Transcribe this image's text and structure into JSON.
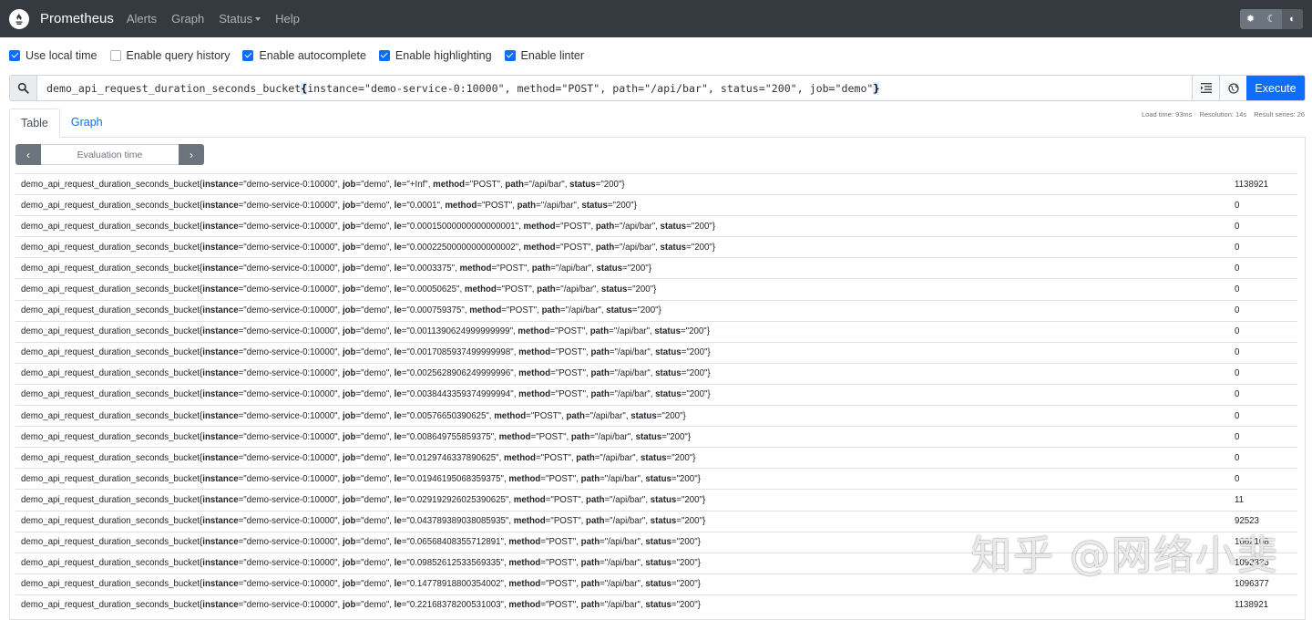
{
  "nav": {
    "brand": "Prometheus",
    "links": [
      "Alerts",
      "Graph",
      "Status",
      "Help"
    ]
  },
  "options": [
    {
      "label": "Use local time",
      "checked": true
    },
    {
      "label": "Enable query history",
      "checked": false
    },
    {
      "label": "Enable autocomplete",
      "checked": true
    },
    {
      "label": "Enable highlighting",
      "checked": true
    },
    {
      "label": "Enable linter",
      "checked": true
    }
  ],
  "query": {
    "metric": "demo_api_request_duration_seconds_bucket",
    "open_brace": "{",
    "labels": "instance=\"demo-service-0:10000\", method=\"POST\", path=\"/api/bar\", status=\"200\", job=\"demo\"",
    "close_brace": "}",
    "execute_label": "Execute"
  },
  "stats": {
    "load_time": "Load time: 93ms",
    "resolution": "Resolution: 14s",
    "result_series": "Result series: 26"
  },
  "tabs": [
    "Table",
    "Graph"
  ],
  "eval": {
    "placeholder": "Evaluation time"
  },
  "results": [
    {
      "le": "+Inf",
      "value": "1138921"
    },
    {
      "le": "0.0001",
      "value": "0"
    },
    {
      "le": "0.00015000000000000001",
      "value": "0"
    },
    {
      "le": "0.00022500000000000002",
      "value": "0"
    },
    {
      "le": "0.0003375",
      "value": "0"
    },
    {
      "le": "0.00050625",
      "value": "0"
    },
    {
      "le": "0.000759375",
      "value": "0"
    },
    {
      "le": "0.0011390624999999999",
      "value": "0"
    },
    {
      "le": "0.0017085937499999998",
      "value": "0"
    },
    {
      "le": "0.0025628906249999996",
      "value": "0"
    },
    {
      "le": "0.0038443359374999994",
      "value": "0"
    },
    {
      "le": "0.00576650390625",
      "value": "0"
    },
    {
      "le": "0.008649755859375",
      "value": "0"
    },
    {
      "le": "0.0129746337890625",
      "value": "0"
    },
    {
      "le": "0.01946195068359375",
      "value": "0"
    },
    {
      "le": "0.029192926025390625",
      "value": "11"
    },
    {
      "le": "0.043789389038085935",
      "value": "92523"
    },
    {
      "le": "0.06568408355712891",
      "value": "1062108"
    },
    {
      "le": "0.09852612533569335",
      "value": "1092335"
    },
    {
      "le": "0.14778918800354002",
      "value": "1096377"
    },
    {
      "le": "0.22168378200531003",
      "value": "1138921"
    }
  ],
  "series_labels": {
    "metric": "demo_api_request_duration_seconds_bucket",
    "instance": "demo-service-0:10000",
    "job": "demo",
    "method": "POST",
    "path": "/api/bar",
    "status": "200"
  },
  "watermark": "知乎 @网络小斐"
}
